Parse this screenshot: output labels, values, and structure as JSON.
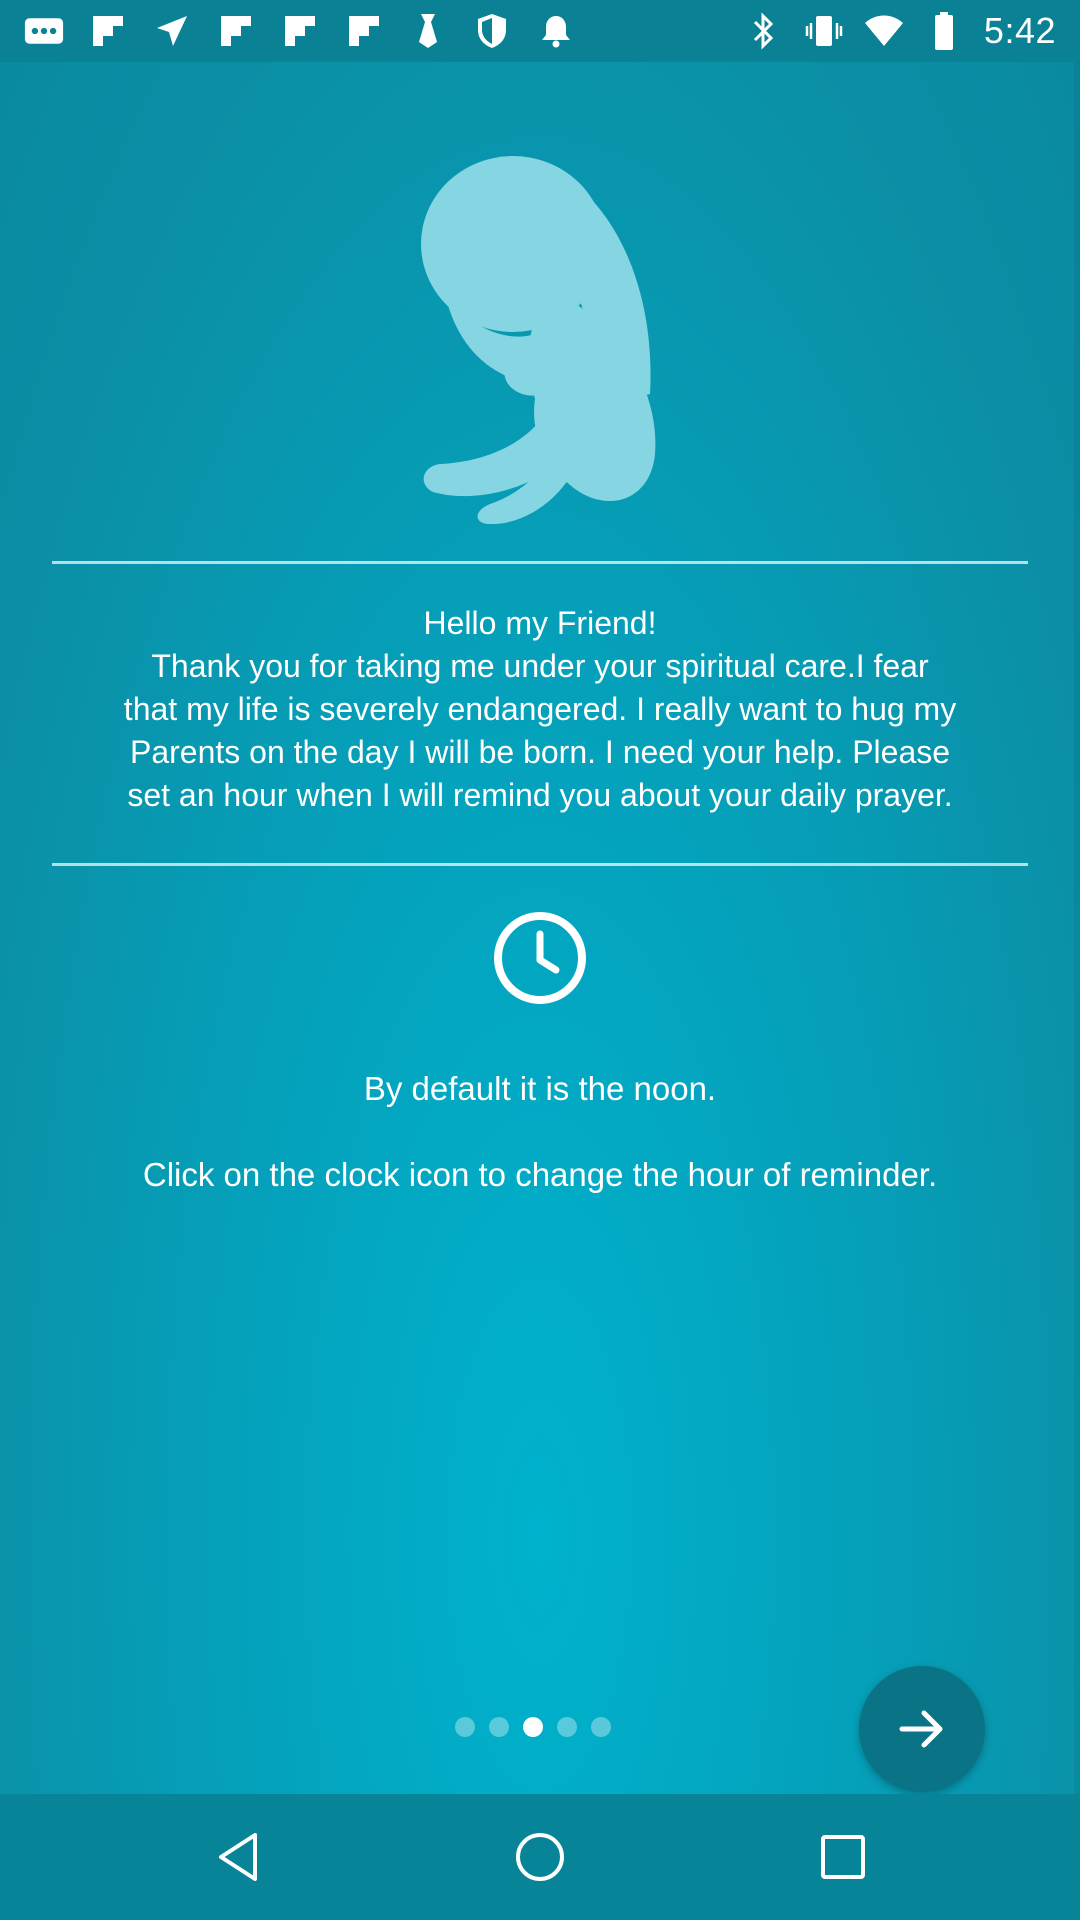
{
  "status_bar": {
    "time": "5:42",
    "left_icons": [
      "more-notifications-icon",
      "flipboard-icon",
      "arrow-icon",
      "flipboard-icon",
      "flipboard-icon",
      "flipboard-icon",
      "tie-icon",
      "shield-icon",
      "bell-icon"
    ],
    "right_icons": [
      "bluetooth-icon",
      "vibrate-icon",
      "wifi-icon",
      "battery-icon"
    ]
  },
  "onboarding": {
    "message_lines": [
      "Hello my Friend!",
      "Thank you for taking me under your spiritual care.I fear",
      "that my life is severely endangered. I really want to hug my",
      "Parents on the day I will be born. I need your help. Please",
      "set an hour when I will remind you about your daily prayer."
    ],
    "default_text": "By default it is the noon.",
    "instruction_text": "Click on the clock icon to change the hour of reminder.",
    "pager": {
      "total": 5,
      "active_index": 2
    },
    "next_icon": "arrow-right-icon",
    "clock_icon": "clock-icon"
  },
  "colors": {
    "background": "#04a3bd",
    "illustration": "#86d5e2",
    "next_button": "#0a7385",
    "text": "#ffffff"
  },
  "nav_bar": {
    "icons": [
      "back-icon",
      "home-icon",
      "recents-icon"
    ]
  }
}
